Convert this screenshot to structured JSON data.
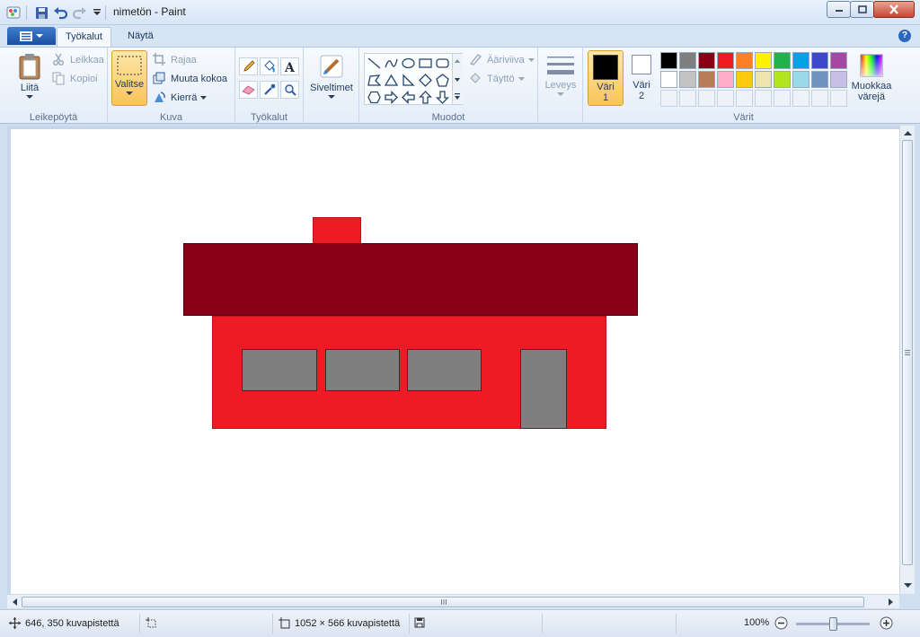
{
  "window": {
    "title": "nimetön - Paint"
  },
  "tabs": {
    "tools": "Työkalut",
    "view": "Näytä"
  },
  "clipboard": {
    "paste": "Liitä",
    "cut": "Leikkaa",
    "copy": "Kopioi",
    "label": "Leikepöytä"
  },
  "image": {
    "select": "Valitse",
    "crop": "Rajaa",
    "resize": "Muuta kokoa",
    "rotate": "Kierrä",
    "label": "Kuva"
  },
  "tools": {
    "label": "Työkalut"
  },
  "brushes": {
    "label": "Siveltimet"
  },
  "shapes": {
    "outline": "Ääriviiva",
    "fill": "Täyttö",
    "label": "Muodot"
  },
  "size": {
    "label": "Leveys"
  },
  "colors": {
    "color1_label": "Väri 1",
    "color1_line1": "Väri",
    "color1_line2": "1",
    "color2_label": "Väri 2",
    "color2_line1": "Väri",
    "color2_line2": "2",
    "edit_line1": "Muokkaa",
    "edit_line2": "värejä",
    "label": "Värit",
    "color1": "#000000",
    "color2": "#ffffff",
    "palette_row1": [
      "#000000",
      "#7f7f7f",
      "#880015",
      "#ed1c24",
      "#ff7f27",
      "#fff200",
      "#22b14c",
      "#00a2e8",
      "#3f48cc",
      "#a349a4"
    ],
    "palette_row2": [
      "#ffffff",
      "#c3c3c3",
      "#b97a57",
      "#ffaec9",
      "#ffc90e",
      "#efe4b0",
      "#b5e61d",
      "#99d9ea",
      "#7092be",
      "#c8bfe7"
    ]
  },
  "drawing": {
    "roof_color": "#880015",
    "wall_color": "#ed1c24",
    "chimney_color": "#ed1c24",
    "window_color": "#7f7f7f",
    "door_color": "#7f7f7f"
  },
  "status": {
    "cursor_pos": "646, 350 kuvapistettä",
    "image_size": "1052 × 566 kuvapistettä",
    "zoom": "100%",
    "zoom_level": 1.0
  }
}
